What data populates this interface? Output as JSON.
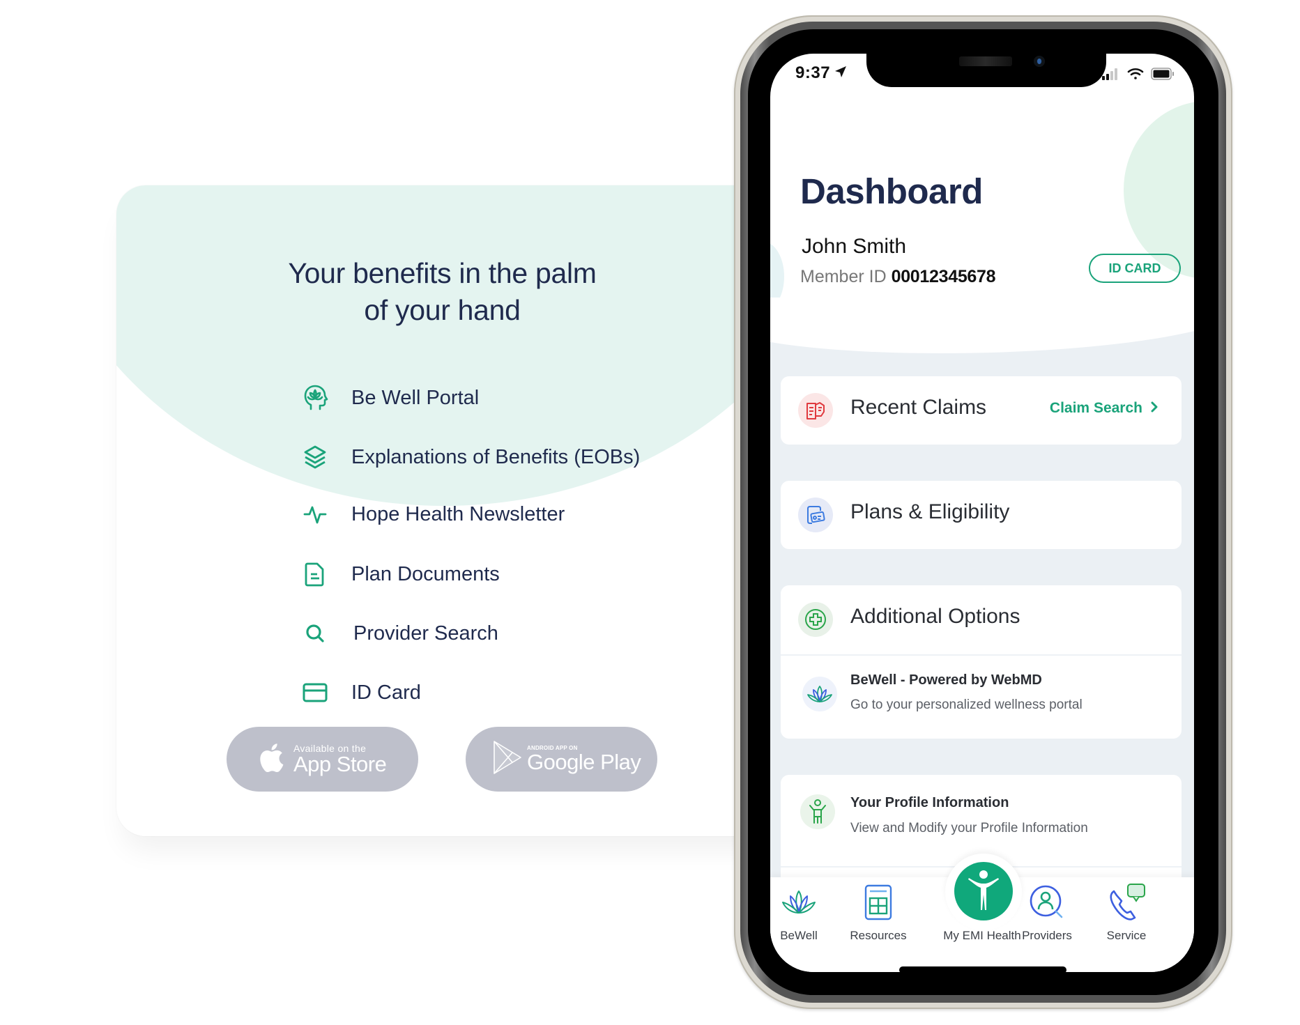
{
  "promo": {
    "heading_line1": "Your benefits in the palm",
    "heading_line2": "of your hand",
    "features": [
      {
        "icon": "lotus-head-icon",
        "label": "Be Well Portal"
      },
      {
        "icon": "layers-icon",
        "label": "Explanations of Benefits (EOBs)"
      },
      {
        "icon": "activity-pulse-icon",
        "label": "Hope Health Newsletter"
      },
      {
        "icon": "document-icon",
        "label": "Plan Documents"
      },
      {
        "icon": "search-icon",
        "label": "Provider Search"
      },
      {
        "icon": "credit-card-icon",
        "label": "ID Card"
      }
    ],
    "app_store": {
      "small": "Available on the",
      "big": "App Store"
    },
    "google_play": {
      "small": "ANDROID APP ON",
      "big": "Google Play"
    },
    "colors": {
      "accent": "#1aa37a",
      "text": "#1f2a4d",
      "store_button": "#bec0cb",
      "blob": "#e4f4f0"
    }
  },
  "phone": {
    "status_bar": {
      "time": "9:37"
    },
    "dashboard": {
      "title": "Dashboard",
      "member_name": "John Smith",
      "member_id_label": "Member ID",
      "member_id_value": "00012345678",
      "id_card_button": "ID CARD"
    },
    "cards": {
      "recent_claims": {
        "title": "Recent Claims",
        "link": "Claim Search"
      },
      "plans": {
        "title": "Plans & Eligibility"
      },
      "additional": {
        "title": "Additional Options",
        "items": [
          {
            "title": "BeWell - Powered by WebMD",
            "desc": "Go to your personalized wellness portal"
          }
        ]
      },
      "profile": {
        "title": "Your Profile Information",
        "desc": "View and Modify your Profile Information"
      }
    },
    "bottom_nav": {
      "items": [
        {
          "label": "BeWell"
        },
        {
          "label": "Resources"
        },
        {
          "label": "My EMI Health"
        },
        {
          "label": "Providers"
        },
        {
          "label": "Service"
        }
      ]
    },
    "colors": {
      "accent": "#1aa37a",
      "center_button": "#10a87b",
      "background": "#ebf0f4",
      "claims_icon": "#e0393e",
      "plans_icon": "#3d7be0"
    }
  }
}
